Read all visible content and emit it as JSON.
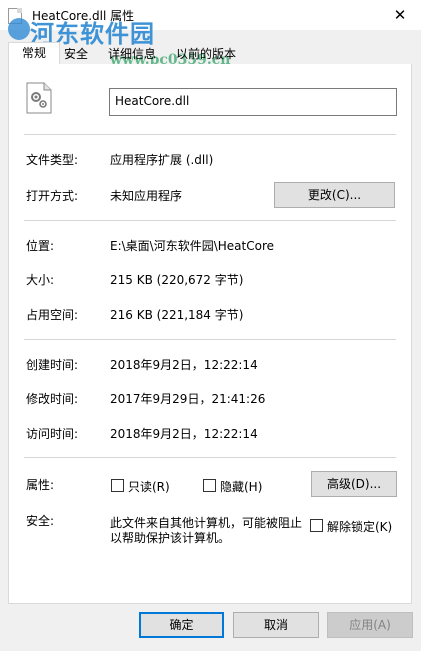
{
  "window": {
    "title": "HeatCore.dll 属性",
    "close_glyph": "✕"
  },
  "watermark": {
    "text": "河东软件园",
    "url": "www.pc0359.cn"
  },
  "tabs": [
    {
      "label": "常规"
    },
    {
      "label": "安全"
    },
    {
      "label": "详细信息"
    },
    {
      "label": "以前的版本"
    }
  ],
  "file": {
    "icon": "dll-gear-file-icon",
    "name": "HeatCore.dll"
  },
  "fields": {
    "type_label": "文件类型:",
    "type_value": "应用程序扩展 (.dll)",
    "opens_label": "打开方式:",
    "opens_value": "未知应用程序",
    "change_button": "更改(C)...",
    "location_label": "位置:",
    "location_value": "E:\\桌面\\河东软件园\\HeatCore",
    "size_label": "大小:",
    "size_value": "215 KB (220,672 字节)",
    "disk_label": "占用空间:",
    "disk_value": "216 KB (221,184 字节)",
    "created_label": "创建时间:",
    "created_value": "2018年9月2日，12:22:14",
    "modified_label": "修改时间:",
    "modified_value": "2017年9月29日，21:41:26",
    "accessed_label": "访问时间:",
    "accessed_value": "2018年9月2日，12:22:14",
    "attributes_label": "属性:",
    "readonly_label": "只读(R)",
    "readonly_checked": false,
    "hidden_label": "隐藏(H)",
    "hidden_checked": false,
    "advanced_button": "高级(D)...",
    "security_label": "安全:",
    "security_text_1": "此文件来自其他计算机，可能被阻止",
    "security_text_2": "以帮助保护该计算机。",
    "unblock_label": "解除锁定(K)",
    "unblock_checked": false
  },
  "footer": {
    "ok": "确定",
    "cancel": "取消",
    "apply": "应用(A)"
  },
  "colors": {
    "accent": "#0078d7",
    "watermark": "#2f8bd4"
  }
}
